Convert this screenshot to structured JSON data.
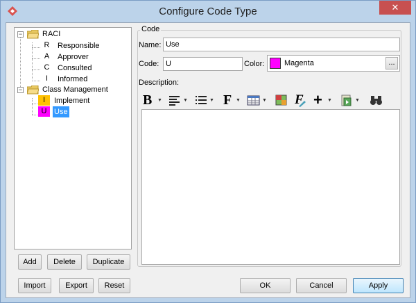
{
  "window": {
    "title": "Configure Code Type",
    "close_glyph": "✕"
  },
  "tree": {
    "groups": [
      {
        "name": "RACI",
        "items": [
          {
            "code": "R",
            "label": "Responsible"
          },
          {
            "code": "A",
            "label": "Approver"
          },
          {
            "code": "C",
            "label": "Consulted"
          },
          {
            "code": "I",
            "label": "Informed"
          }
        ]
      },
      {
        "name": "Class Management",
        "items": [
          {
            "code": "I",
            "label": "Implement",
            "color": "#ffc000"
          },
          {
            "code": "U",
            "label": "Use",
            "color": "#ff00ff",
            "selected": true
          }
        ]
      }
    ]
  },
  "list_buttons": {
    "add": "Add",
    "delete": "Delete",
    "duplicate": "Duplicate"
  },
  "bottom_buttons": {
    "import": "Import",
    "export": "Export",
    "reset": "Reset",
    "ok": "OK",
    "cancel": "Cancel",
    "apply": "Apply"
  },
  "code_group": {
    "title": "Code",
    "name_label": "Name:",
    "name_value": "Use",
    "code_label": "Code:",
    "code_value": "U",
    "color_label": "Color:",
    "color_name": "Magenta",
    "color_value": "#ff00ff",
    "color_button": "...",
    "description_label": "Description:"
  },
  "toolbar_icons": [
    "bold-icon",
    "align-icon",
    "list-icon",
    "font-icon",
    "table-icon",
    "image-icon",
    "format-icon",
    "insert-icon",
    "paste-icon",
    "find-icon"
  ],
  "colors": {
    "selection": "#3399ff",
    "implement": "#ffc000",
    "use": "#ff00ff",
    "titlebar": "#bcd3ea"
  }
}
